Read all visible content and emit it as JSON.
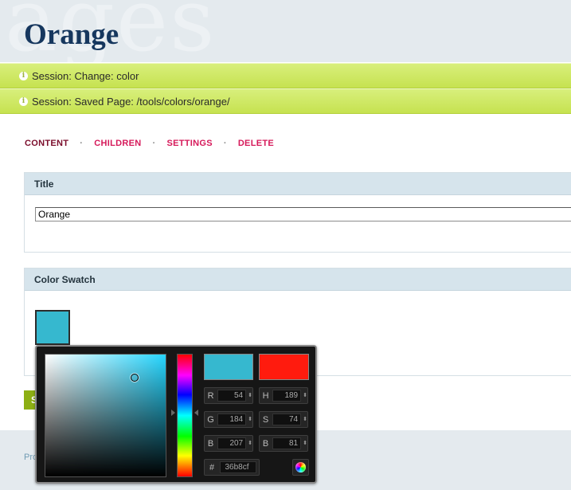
{
  "header": {
    "watermark": "ages",
    "title": "Orange"
  },
  "notices": [
    {
      "text": "Session: Change: color"
    },
    {
      "text": "Session: Saved Page: /tools/colors/orange/"
    }
  ],
  "tabs": [
    {
      "label": "CONTENT",
      "active": true
    },
    {
      "label": "CHILDREN"
    },
    {
      "label": "SETTINGS"
    },
    {
      "label": "DELETE"
    }
  ],
  "tab_separator": "·",
  "title_panel": {
    "heading": "Title",
    "value": "Orange"
  },
  "color_panel": {
    "heading": "Color Swatch",
    "swatch_color": "#36b8cf"
  },
  "save_button": {
    "label": "S"
  },
  "footer": {
    "text": "Pro"
  },
  "color_picker": {
    "new_color": "#36b8cf",
    "current_color": "#ff1b0e",
    "fields": {
      "r": {
        "label": "R",
        "value": "54"
      },
      "g": {
        "label": "G",
        "value": "184"
      },
      "b": {
        "label": "B",
        "value": "207"
      },
      "h": {
        "label": "H",
        "value": "189"
      },
      "s": {
        "label": "S",
        "value": "74"
      },
      "v": {
        "label": "B",
        "value": "81"
      },
      "hex": {
        "label": "#",
        "value": "36b8cf"
      }
    },
    "spin_glyph": "⬍"
  },
  "icons": {
    "info": "info-icon",
    "wheel": "color-wheel-icon"
  },
  "colors": {
    "accent": "#d6195a",
    "active_tab": "#7b0d2b",
    "notice": "#c6e250",
    "title": "#16375e"
  }
}
